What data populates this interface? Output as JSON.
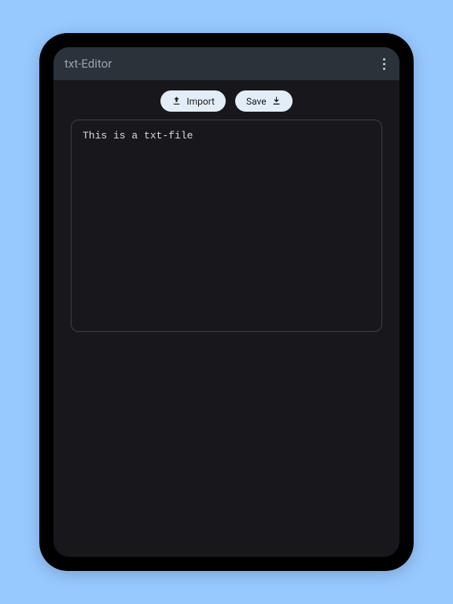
{
  "titlebar": {
    "title": "txt-Editor"
  },
  "toolbar": {
    "import_label": "Import",
    "save_label": "Save"
  },
  "editor": {
    "content": "This is a txt-file"
  }
}
